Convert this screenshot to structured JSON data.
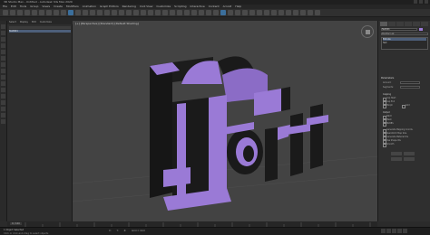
{
  "app": {
    "title": "3D Studio Max - Untitled - Autodesk 3ds Max 2020",
    "menus": [
      "File",
      "Edit",
      "Tools",
      "Group",
      "Views",
      "Create",
      "Modifiers",
      "Animation",
      "Graph Editors",
      "Rendering",
      "Civil View",
      "Customize",
      "Scripting",
      "Interactive",
      "Content",
      "Arnold",
      "Help"
    ]
  },
  "scene_explorer": {
    "tabs": [
      "Select",
      "Display",
      "Edit",
      "Customize"
    ],
    "selected_item": "Text001"
  },
  "viewport": {
    "label": "[+] [Perspective] [Standard] [Default Shading]",
    "object_text": "mart"
  },
  "command_panel": {
    "object_name": "Text001",
    "modifier_list_label": "Modifier List",
    "stack": [
      "Extrude",
      "Text"
    ],
    "sections": {
      "parameters": "Parameters",
      "amount_label": "Amount:",
      "segments_label": "Segments:",
      "capping": "Capping",
      "cap_start": "Cap Start",
      "cap_end": "Cap End",
      "morph": "Morph",
      "grid": "Grid",
      "output": "Output",
      "patch": "Patch",
      "mesh": "Mesh",
      "nurbs": "NURBS",
      "gen_map": "Generate Mapping Coords.",
      "real_world": "Real-World Map Size",
      "gen_mat": "Generate Material IDs",
      "use_shape": "Use Shape IDs",
      "smooth": "Smooth"
    }
  },
  "timeline": {
    "frame_display": "0 / 100"
  },
  "status": {
    "selection": "1 Object Selected",
    "hint": "Click or click-and-drag to select objects",
    "x_label": "X:",
    "y_label": "Y:",
    "z_label": "Z:",
    "grid_label": "Grid = 10.0"
  },
  "colors": {
    "object_purple": "#9a7ad6",
    "object_side": "#1a1a1a",
    "viewport_bg": "#434343"
  }
}
